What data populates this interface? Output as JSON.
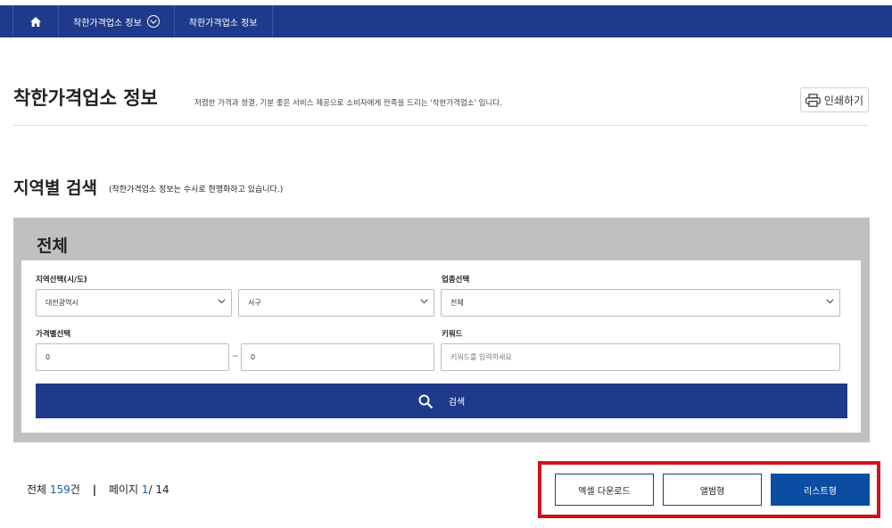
{
  "nav": {
    "breadcrumb": [
      {
        "label": "착한가격업소 정보"
      },
      {
        "label": "착한가격업소 정보"
      }
    ]
  },
  "header": {
    "title": "착한가격업소 정보",
    "description": "저렴한 가격과 청결, 기분 좋은 서비스 제공으로 소비자에게 만족을 드리는 '착한가격업소' 입니다.",
    "print_label": "인쇄하기"
  },
  "section": {
    "title": "지역별 검색",
    "note": "(착한가격업소 정보는 수시로 현행화하고 있습니다.)"
  },
  "search": {
    "panel_title": "전체",
    "region_label": "지역선택(시/도)",
    "city_value": "대전광역시",
    "district_value": "서구",
    "category_label": "업종선택",
    "category_value": "전체",
    "price_label": "가격별선택",
    "price_min": "0",
    "price_sep": "~",
    "price_max": "0",
    "keyword_label": "키워드",
    "keyword_placeholder": "키워드를 입력하세요",
    "search_label": "검색"
  },
  "results": {
    "total_prefix": "전체 ",
    "total_count": "159",
    "total_suffix": "건",
    "separator": "|",
    "page_prefix": "페이지 ",
    "current_page": "1",
    "page_total": "/ 14"
  },
  "view_buttons": {
    "excel": "엑셀 다운로드",
    "album": "앨범형",
    "list": "리스트형"
  },
  "colors": {
    "nav_bg": "#1f3a8a",
    "highlight": "#d0121b",
    "list_btn": "#0b4da2"
  }
}
